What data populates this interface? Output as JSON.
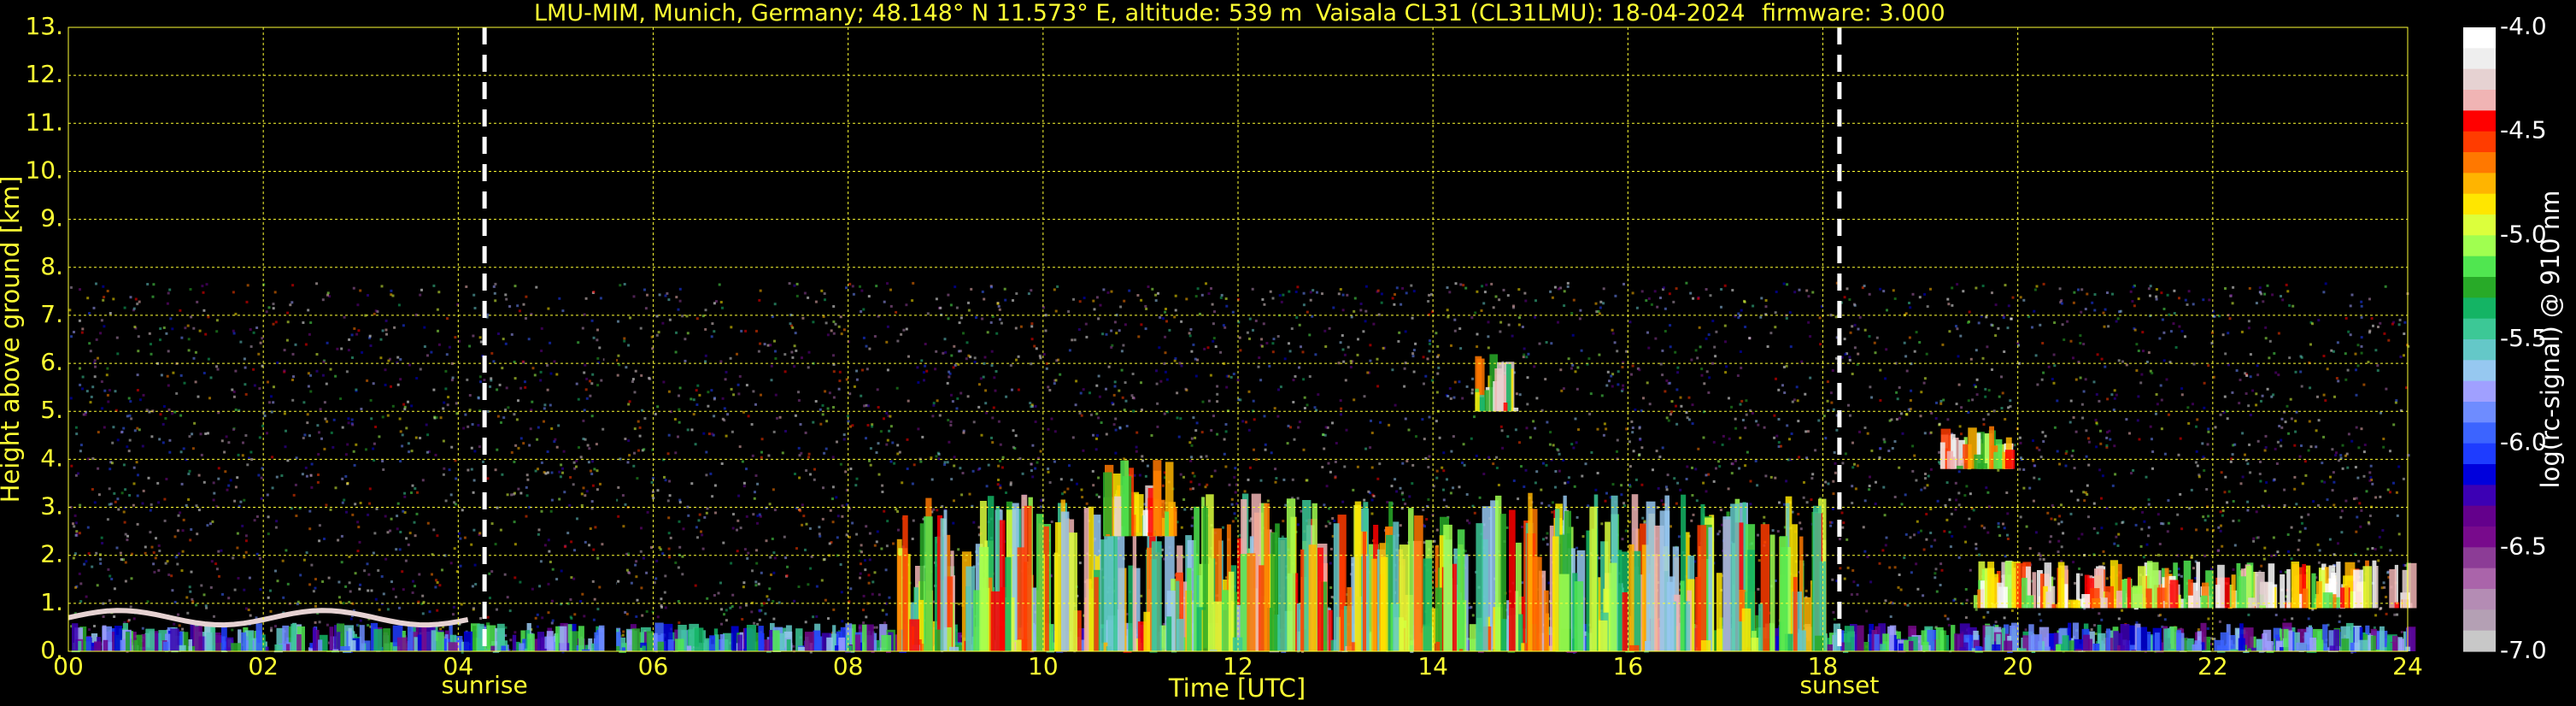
{
  "title": {
    "station": "LMU-MIM, Munich, Germany; 48.148° N 11.573° E, altitude: 539 m",
    "instrument": "Vaisala CL31 (CL31LMU): 18-04-2024",
    "firmware": "firmware: 3.000"
  },
  "chart_data": {
    "type": "heatmap",
    "xlabel": "Time [UTC]",
    "ylabel": "Height above ground [km]",
    "xlim": [
      0,
      24
    ],
    "ylim": [
      0,
      13
    ],
    "x_ticks": [
      "00",
      "02",
      "04",
      "06",
      "08",
      "10",
      "12",
      "14",
      "16",
      "18",
      "20",
      "22",
      "24"
    ],
    "y_ticks": [
      "0.",
      "1.",
      "2.",
      "3.",
      "4.",
      "5.",
      "6.",
      "7.",
      "8.",
      "9.",
      "10.",
      "11.",
      "12.",
      "13."
    ],
    "grid": true,
    "data_top_km": 7.7,
    "gap_hours": [
      5.5,
      5.62
    ],
    "markers": [
      {
        "label": "sunrise",
        "hour": 4.27
      },
      {
        "label": "sunset",
        "hour": 18.17
      }
    ],
    "colorbar": {
      "label": "log(rc-signal) @ 910 nm",
      "range": [
        -7.0,
        -4.0
      ],
      "ticks": [
        "-4.0",
        "-4.5",
        "-5.0",
        "-5.5",
        "-6.0",
        "-6.5",
        "-7.0"
      ],
      "colors": [
        "#ffffff",
        "#eeeeee",
        "#e6d2d2",
        "#f0b4b4",
        "#ff0000",
        "#ff3c00",
        "#ff7800",
        "#ffb400",
        "#ffe600",
        "#dcff3c",
        "#a0ff50",
        "#50e650",
        "#28aa28",
        "#14b464",
        "#3cc896",
        "#64c8c8",
        "#96c8f0",
        "#a0a0ff",
        "#6e8cff",
        "#3c64ff",
        "#1e3cff",
        "#0000dc",
        "#3c00b4",
        "#64008c",
        "#780a8c",
        "#8c3c96",
        "#aa64aa",
        "#b48cb4",
        "#b4a0b4",
        "#c8c8c8"
      ]
    },
    "features": [
      {
        "name": "low aerosol layer",
        "t0": 0,
        "t1": 24,
        "h0": 0,
        "h1": 0.6,
        "level": -5.8
      },
      {
        "name": "boundary layer top night",
        "t0": 0,
        "t1": 4.2,
        "h": 0.7,
        "level": -4.2
      },
      {
        "name": "daytime convective plumes",
        "t0": 8.5,
        "t1": 18,
        "h0": 0,
        "h1": 3.3,
        "level": -5.0
      },
      {
        "name": "mid-level cloud",
        "t0": 10.6,
        "t1": 11.3,
        "h0": 2.4,
        "h1": 4.0,
        "level": -4.7
      },
      {
        "name": "mid-level cloud",
        "t0": 14.4,
        "t1": 14.8,
        "h0": 5.0,
        "h1": 6.4,
        "level": -4.8
      },
      {
        "name": "mid-level cloud",
        "t0": 19.2,
        "t1": 19.9,
        "h0": 3.8,
        "h1": 4.7,
        "level": -4.7
      },
      {
        "name": "evening layer",
        "t0": 19.5,
        "t1": 24,
        "h0": 0.9,
        "h1": 1.9,
        "level": -4.5
      }
    ]
  }
}
